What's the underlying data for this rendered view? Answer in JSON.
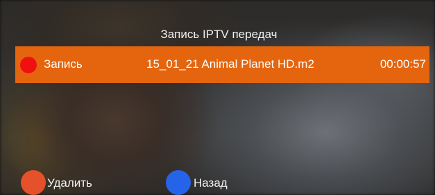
{
  "screen": {
    "title": "Запись IPTV передач"
  },
  "recordings": [
    {
      "status_label": "Запись",
      "file_name": "15_01_21 Animal Planet HD.m2",
      "duration": "00:00:57"
    }
  ],
  "key_hints": {
    "delete": {
      "label": "Удалить",
      "color": "#e4512a"
    },
    "back": {
      "label": "Назад",
      "color": "#2563e8"
    }
  },
  "colors": {
    "highlight_row": "#e5650f",
    "record_indicator": "#f01010"
  }
}
